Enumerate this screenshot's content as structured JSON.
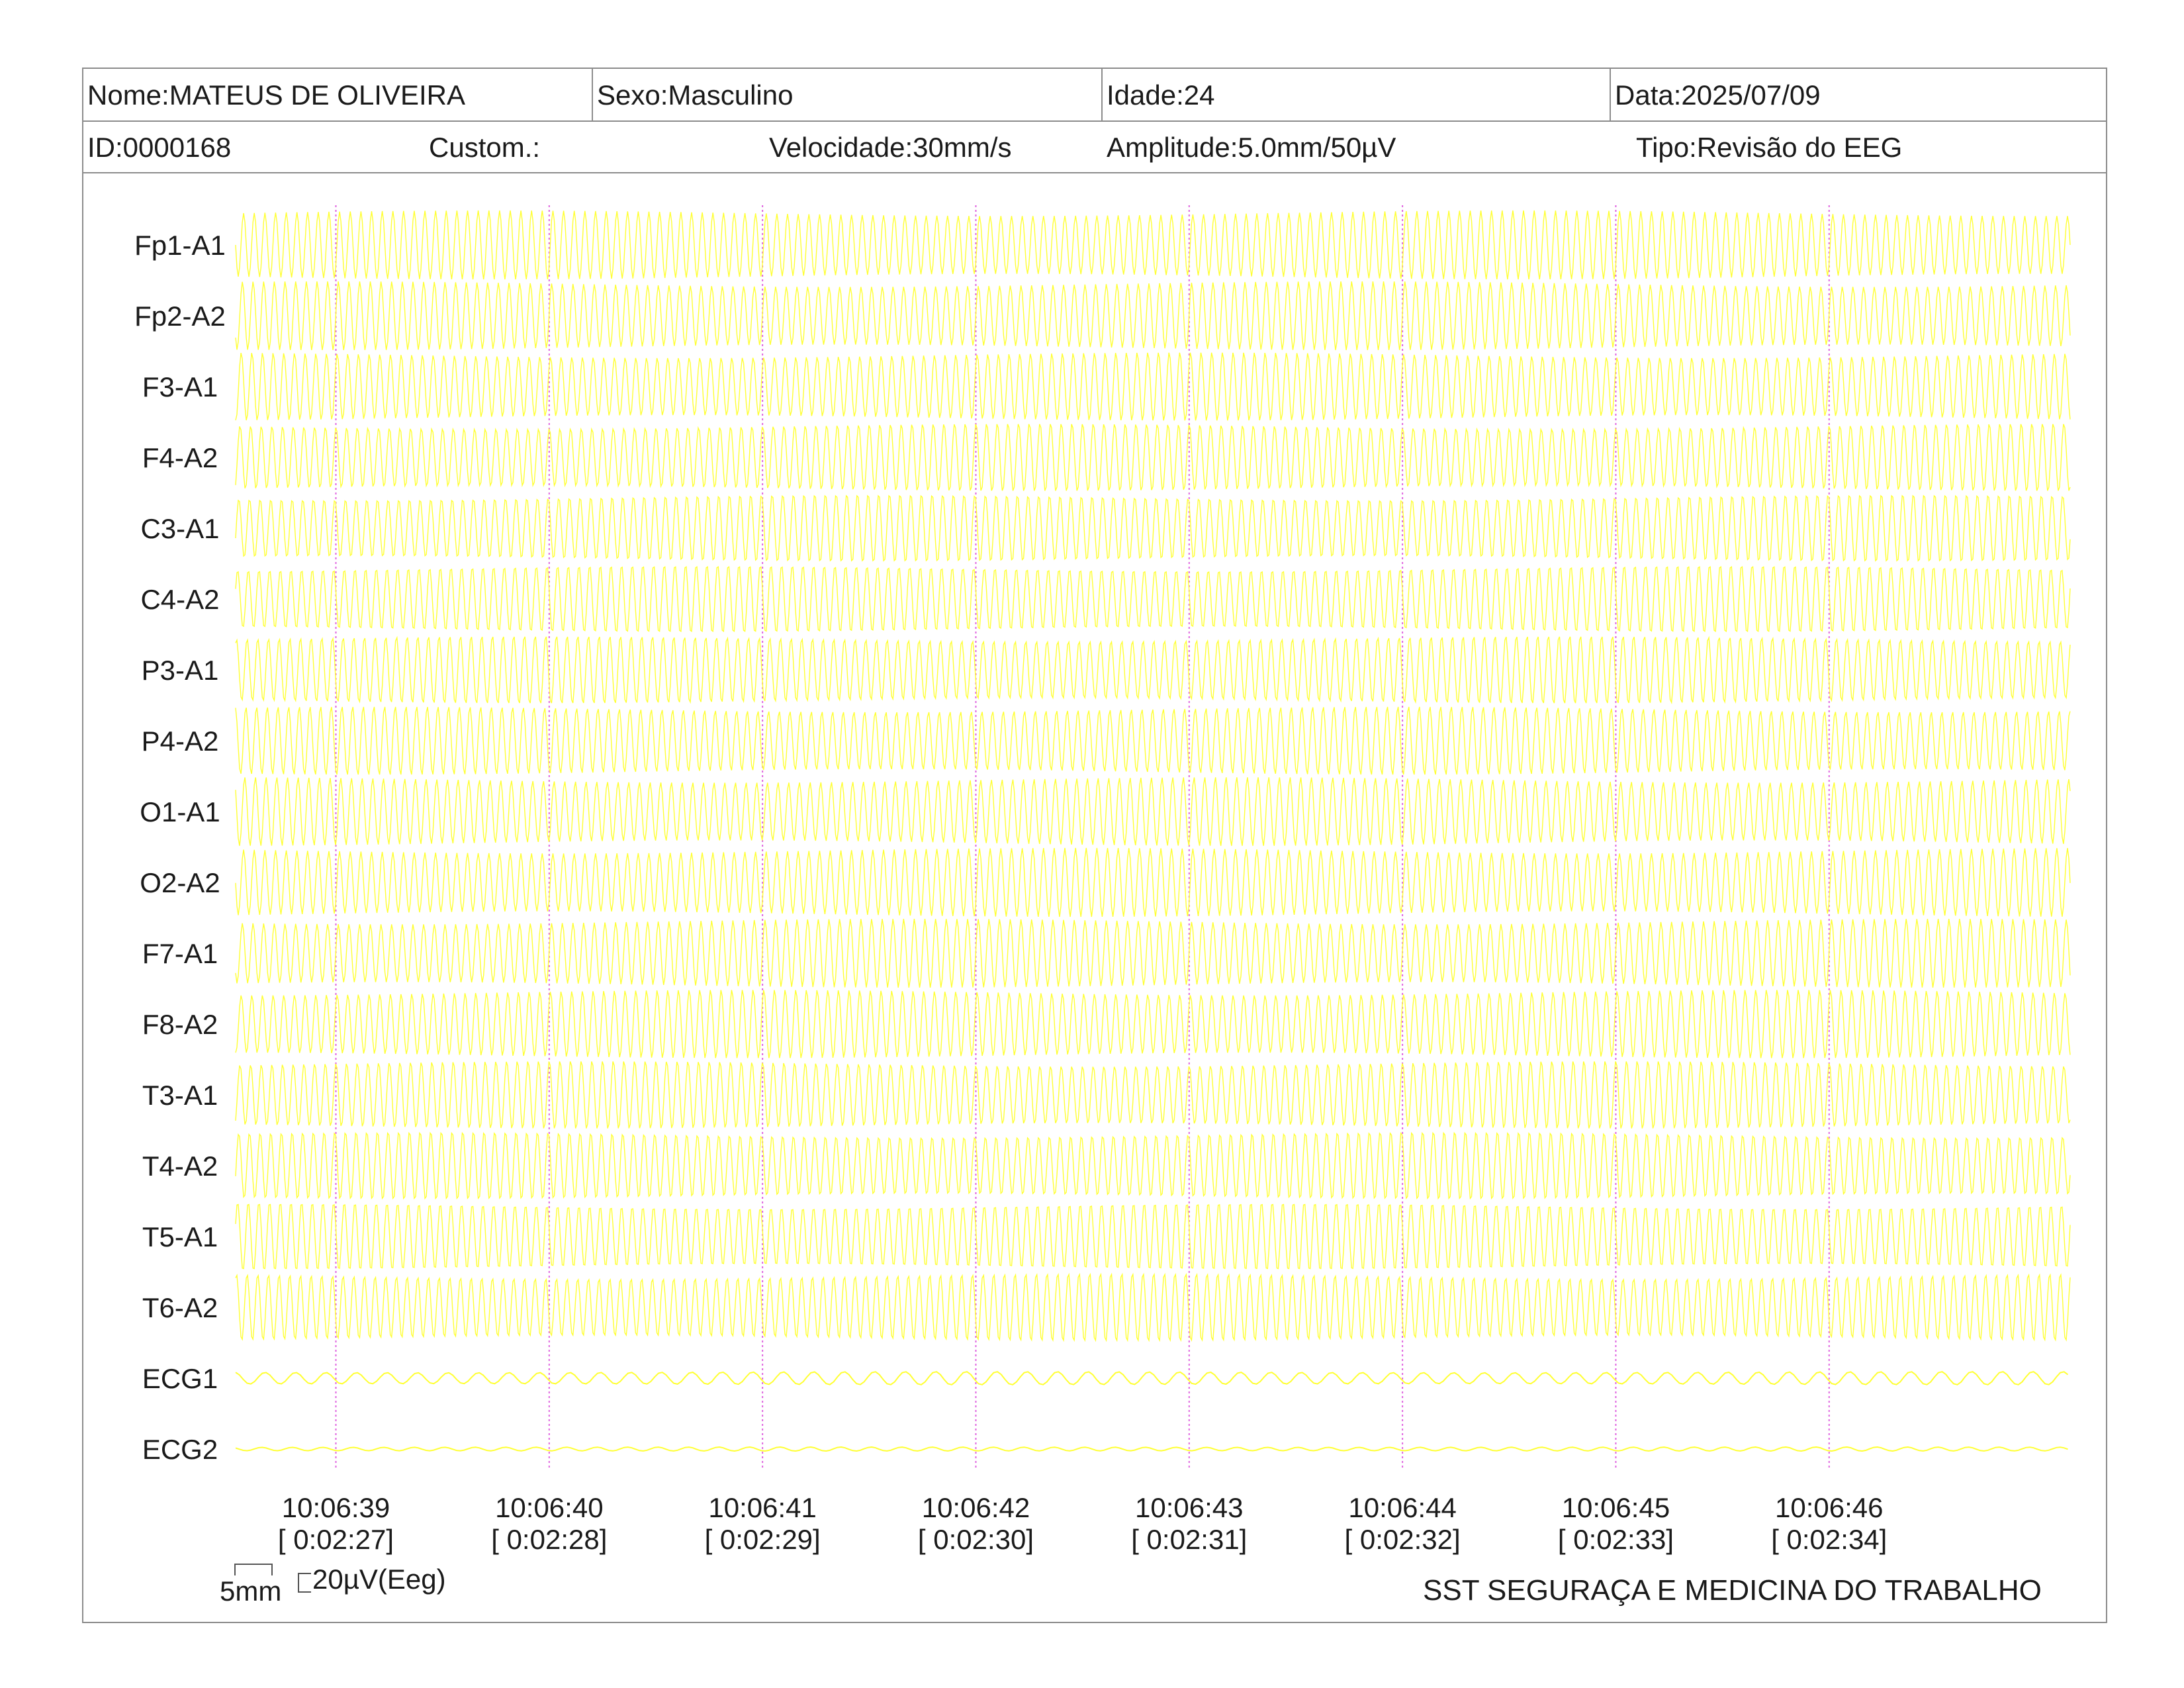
{
  "header": {
    "nome": "Nome:MATEUS DE OLIVEIRA",
    "sexo": "Sexo:Masculino",
    "idade": "Idade:24",
    "data": "Data:2025/07/09",
    "id": "ID:0000168",
    "custom": "Custom.:",
    "velocidade": "Velocidade:30mm/s",
    "amplitude": "Amplitude:5.0mm/50µV",
    "tipo": "Tipo:Revisão do EEG"
  },
  "scale": {
    "mm_label": "5mm",
    "uv_label": "20µV(Eeg)"
  },
  "footer": {
    "organization": "SST SEGURAÇA E MEDICINA DO TRABALHO"
  },
  "colors": {
    "trace": "#ffff33",
    "marker": "#e066e0",
    "border": "#8c8c8c"
  },
  "chart_data": {
    "type": "line",
    "channels": [
      "Fp1-A1",
      "Fp2-A2",
      "F3-A1",
      "F4-A2",
      "C3-A1",
      "C4-A2",
      "P3-A1",
      "P4-A2",
      "O1-A1",
      "O2-A2",
      "F7-A1",
      "F8-A2",
      "T3-A1",
      "T4-A2",
      "T5-A1",
      "T6-A2",
      "ECG1",
      "ECG2"
    ],
    "time_markers": [
      {
        "clock": "10:06:39",
        "elapsed": "[ 0:02:27]"
      },
      {
        "clock": "10:06:40",
        "elapsed": "[ 0:02:28]"
      },
      {
        "clock": "10:06:41",
        "elapsed": "[ 0:02:29]"
      },
      {
        "clock": "10:06:42",
        "elapsed": "[ 0:02:30]"
      },
      {
        "clock": "10:06:43",
        "elapsed": "[ 0:02:31]"
      },
      {
        "clock": "10:06:44",
        "elapsed": "[ 0:02:32]"
      },
      {
        "clock": "10:06:45",
        "elapsed": "[ 0:02:33]"
      },
      {
        "clock": "10:06:46",
        "elapsed": "[ 0:02:34]"
      }
    ],
    "x_range_seconds": [
      0,
      8.6
    ],
    "first_marker_second": 0.47,
    "eeg_frequency_hz": 20,
    "ecg_frequency_hz": 7
  }
}
